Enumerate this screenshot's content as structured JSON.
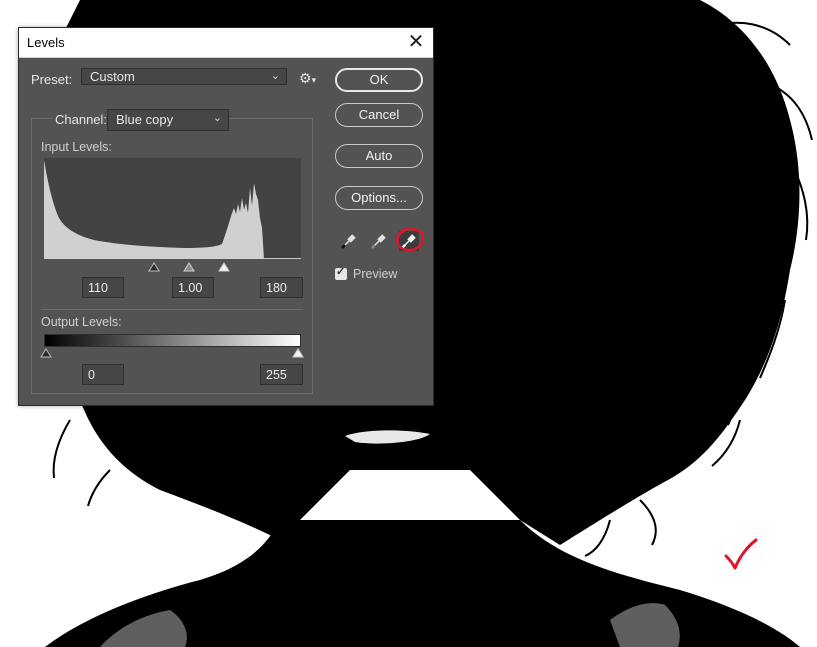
{
  "dialog": {
    "title": "Levels",
    "close_glyph": "✕",
    "preset": {
      "label": "Preset:",
      "value": "Custom"
    },
    "channel": {
      "label": "Channel:",
      "value": "Blue copy"
    },
    "input_levels": {
      "label": "Input Levels:",
      "black": "110",
      "gamma": "1.00",
      "white": "180"
    },
    "output_levels": {
      "label": "Output Levels:",
      "black": "0",
      "white": "255"
    },
    "buttons": {
      "ok": "OK",
      "cancel": "Cancel",
      "auto": "Auto",
      "options": "Options..."
    },
    "preview": {
      "label": "Preview",
      "checked": true
    },
    "eyedroppers": [
      "black-point-eyedropper-icon",
      "gray-point-eyedropper-icon",
      "white-point-eyedropper-icon"
    ],
    "active_eyedropper": "white-point-eyedropper-icon"
  },
  "annotations": {
    "highlight_color": "#e0142b"
  },
  "colors": {
    "dialog_bg": "#535353",
    "histogram_fill": "#d0d0d0",
    "silhouette": "#000000"
  }
}
